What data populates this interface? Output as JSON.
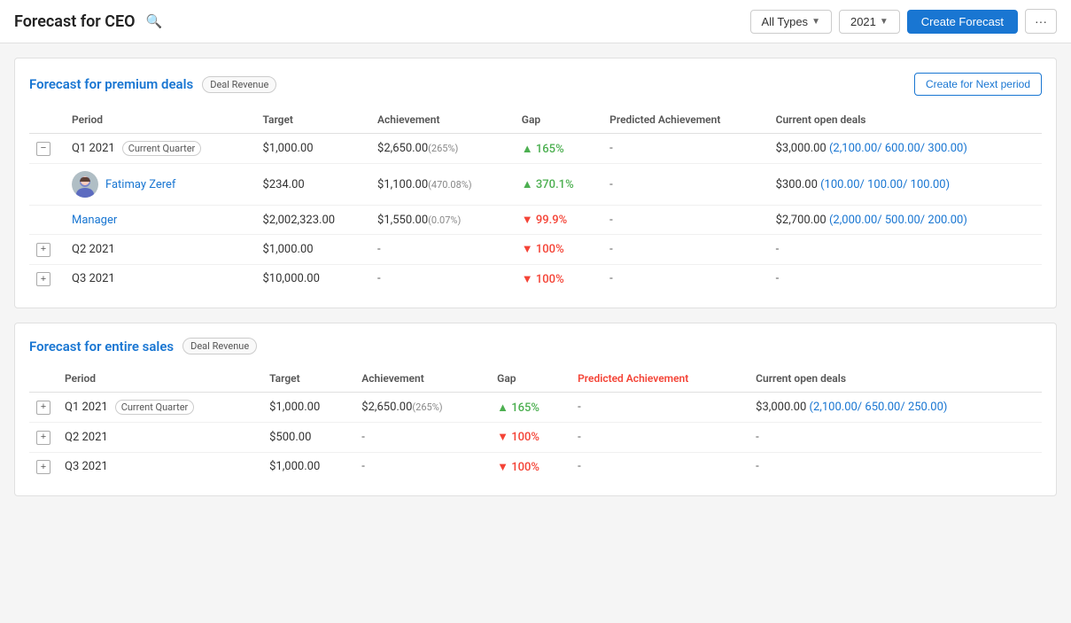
{
  "header": {
    "title": "Forecast for CEO",
    "search_icon": "🔍",
    "filter_type": "All Types",
    "filter_year": "2021",
    "create_forecast_label": "Create Forecast",
    "more_icon": "···"
  },
  "sections": [
    {
      "id": "premium",
      "title": "Forecast for premium deals",
      "badge": "Deal Revenue",
      "create_next_label": "Create for Next period",
      "columns": [
        "Period",
        "Target",
        "Achievement",
        "Gap",
        "Predicted Achievement",
        "Current open deals"
      ],
      "rows": [
        {
          "type": "expandable",
          "expanded": true,
          "period": "Q1 2021",
          "is_current": true,
          "current_label": "Current Quarter",
          "target": "$1,000.00",
          "achievement": "$2,650.00",
          "achievement_pct": "(265%)",
          "gap_direction": "up",
          "gap": "165%",
          "predicted": "-",
          "open_deals_main": "$3,000.00",
          "open_deals_sub": "(2,100.00/ 600.00/ 300.00)"
        },
        {
          "type": "sub_person",
          "period": "Fatimay Zeref",
          "target": "$234.00",
          "achievement": "$1,100.00",
          "achievement_pct": "(470.08%)",
          "gap_direction": "up",
          "gap": "370.1%",
          "predicted": "-",
          "open_deals_main": "$300.00",
          "open_deals_sub": "(100.00/ 100.00/ 100.00)"
        },
        {
          "type": "sub_person",
          "period": "Manager",
          "target": "$2,002,323.00",
          "achievement": "$1,550.00",
          "achievement_pct": "(0.07%)",
          "gap_direction": "down",
          "gap": "99.9%",
          "predicted": "-",
          "open_deals_main": "$2,700.00",
          "open_deals_sub": "(2,000.00/ 500.00/ 200.00)"
        },
        {
          "type": "expandable",
          "expanded": false,
          "period": "Q2 2021",
          "is_current": false,
          "target": "$1,000.00",
          "achievement": "-",
          "gap_direction": "down",
          "gap": "100%",
          "predicted": "-",
          "open_deals_main": "-"
        },
        {
          "type": "expandable",
          "expanded": false,
          "period": "Q3 2021",
          "is_current": false,
          "target": "$10,000.00",
          "achievement": "-",
          "gap_direction": "down",
          "gap": "100%",
          "predicted": "-",
          "open_deals_main": "-"
        }
      ]
    },
    {
      "id": "entire",
      "title": "Forecast for entire sales",
      "badge": "Deal Revenue",
      "create_next_label": null,
      "columns": [
        "Period",
        "Target",
        "Achievement",
        "Gap",
        "Predicted Achievement",
        "Current open deals"
      ],
      "rows": [
        {
          "type": "expandable",
          "expanded": false,
          "period": "Q1 2021",
          "is_current": true,
          "current_label": "Current Quarter",
          "target": "$1,000.00",
          "achievement": "$2,650.00",
          "achievement_pct": "(265%)",
          "gap_direction": "up",
          "gap": "165%",
          "predicted": "-",
          "open_deals_main": "$3,000.00",
          "open_deals_sub": "(2,100.00/ 650.00/ 250.00)"
        },
        {
          "type": "expandable",
          "expanded": false,
          "period": "Q2 2021",
          "is_current": false,
          "target": "$500.00",
          "achievement": "-",
          "gap_direction": "down",
          "gap": "100%",
          "predicted": "-",
          "open_deals_main": "-"
        },
        {
          "type": "expandable",
          "expanded": false,
          "period": "Q3 2021",
          "is_current": false,
          "target": "$1,000.00",
          "achievement": "-",
          "gap_direction": "down",
          "gap": "100%",
          "predicted": "-",
          "open_deals_main": "-"
        }
      ]
    }
  ]
}
